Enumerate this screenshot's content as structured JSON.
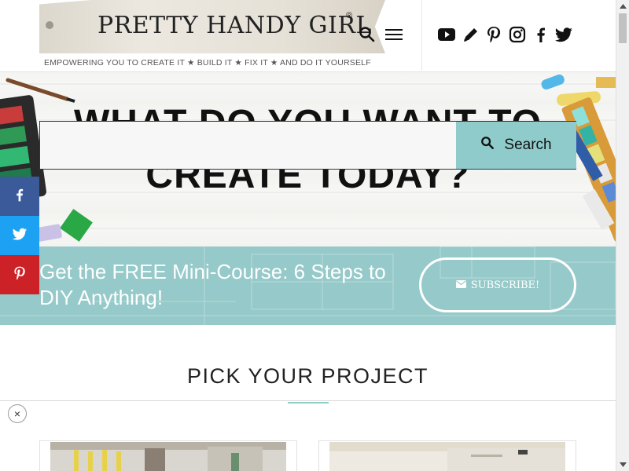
{
  "header": {
    "logo_title": "PRETTY HANDY GIRL",
    "logo_reg": "®",
    "tagline": "EMPOWERING YOU TO CREATE IT  ★  BUILD IT  ★  FIX IT  ★  AND DO IT YOURSELF",
    "icons": [
      "search-icon",
      "menu-icon"
    ],
    "social": [
      "youtube-icon",
      "pencil-icon",
      "pinterest-icon",
      "instagram-icon",
      "facebook-icon",
      "twitter-icon"
    ]
  },
  "hero": {
    "headline_line1": "WHAT DO YOU WANT TO",
    "headline_line2": "CREATE TODAY?",
    "search_placeholder": "",
    "search_button": "Search"
  },
  "banner": {
    "text": "Get the FREE Mini-Course: 6 Steps to DIY Anything!",
    "subscribe_label": "SUBSCRIBE!"
  },
  "share_bar": [
    "facebook-icon",
    "twitter-icon",
    "pinterest-icon"
  ],
  "projects": {
    "title": "PICK YOUR PROJECT",
    "close_label": "×"
  },
  "colors": {
    "accent": "#90cbcb",
    "banner": "#96c9c9",
    "facebook": "#3b5a9a",
    "twitter": "#1da1f2",
    "pinterest": "#cc2127"
  }
}
